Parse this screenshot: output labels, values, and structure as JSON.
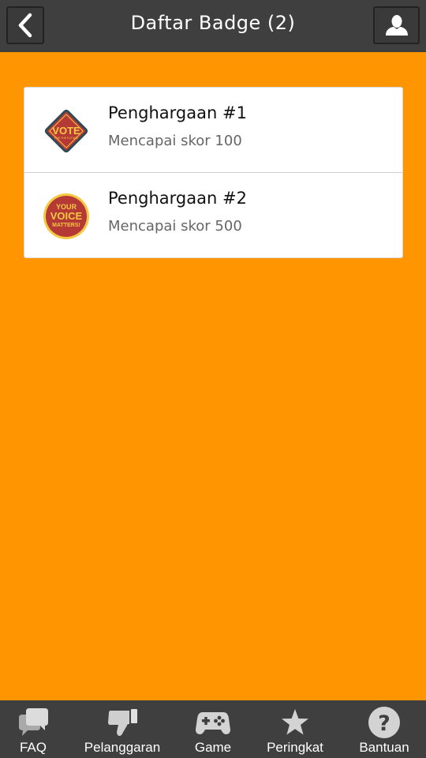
{
  "header": {
    "title": "Daftar Badge (2)",
    "back_icon": "chevron-left-icon",
    "profile_icon": "user-icon"
  },
  "badges": [
    {
      "name": "Penghargaan #1",
      "description": "Mencapai skor 100",
      "icon": "vote-badge-icon",
      "icon_text": [
        "VOTE",
        "FOR THE FUTURE"
      ]
    },
    {
      "name": "Penghargaan #2",
      "description": "Mencapai skor 500",
      "icon": "voice-badge-icon",
      "icon_text": [
        "YOUR",
        "VOICE",
        "MATTERS!"
      ]
    }
  ],
  "bottom_nav": [
    {
      "label": "FAQ",
      "icon": "chat-bubbles-icon"
    },
    {
      "label": "Pelanggaran",
      "icon": "thumbs-down-icon"
    },
    {
      "label": "Game",
      "icon": "gamepad-icon"
    },
    {
      "label": "Peringkat",
      "icon": "star-icon"
    },
    {
      "label": "Bantuan",
      "icon": "help-icon"
    }
  ],
  "colors": {
    "background": "#FF9500",
    "bars": "#3F3F3F",
    "card": "#FFFFFF",
    "badge_red": "#B53A36",
    "badge_yellow": "#F5C842"
  }
}
